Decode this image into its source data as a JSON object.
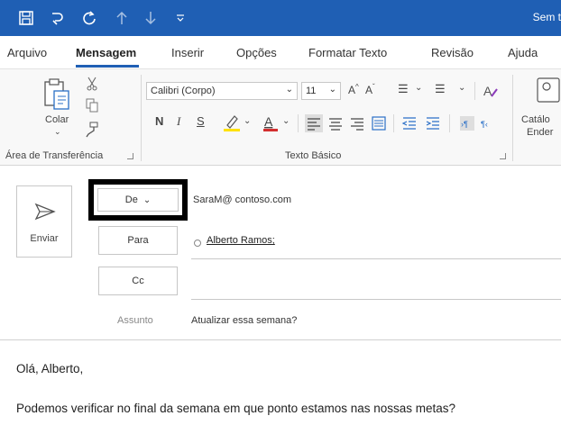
{
  "window": {
    "title": "Sem t"
  },
  "quick_access": [
    "save-icon",
    "undo-icon",
    "redo-icon",
    "up-arrow-icon",
    "down-arrow-icon",
    "customize-icon"
  ],
  "tabs": [
    {
      "label": "Arquivo"
    },
    {
      "label": "Mensagem"
    },
    {
      "label": "Inserir"
    },
    {
      "label": "Opções"
    },
    {
      "label": "Formatar Texto"
    },
    {
      "label": "Revisão"
    },
    {
      "label": "Ajuda"
    }
  ],
  "ribbon": {
    "clipboard": {
      "paste_label": "Colar",
      "group_label": "Área de Transferência"
    },
    "basic_text": {
      "font_name": "Calibri (Corpo)",
      "font_size": "11",
      "bold": "N",
      "italic": "I",
      "underline": "S",
      "font_color": "A",
      "grow_font": "A",
      "shrink_font": "A",
      "group_label": "Texto Básico"
    },
    "names": {
      "label_line1": "Catálo",
      "label_line2": "Ender"
    }
  },
  "compose": {
    "send_label": "Enviar",
    "from_label": "De",
    "from_value": "SaraM@ contoso.com",
    "to_label": "Para",
    "to_value": "Alberto Ramos;",
    "cc_label": "Cc",
    "subject_label": "Assunto",
    "subject_value": "Atualizar essa semana?"
  },
  "message": {
    "greeting": "Olá, Alberto,",
    "line1": "Podemos verificar no final da semana em que ponto estamos nas nossas metas?"
  },
  "colors": {
    "titlebar": "#1f5fb4",
    "highlight": "#ffe100",
    "font_color": "#d32f2f"
  }
}
